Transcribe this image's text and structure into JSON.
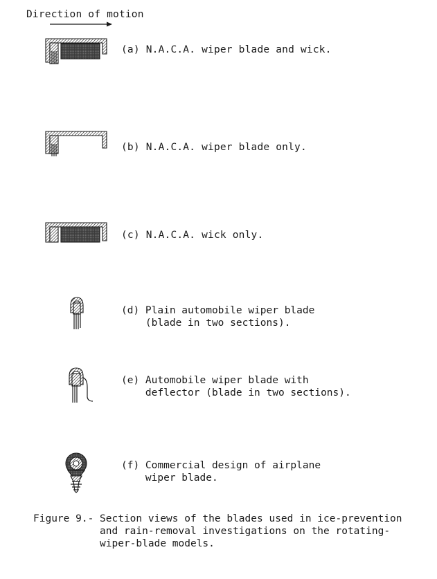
{
  "header": {
    "direction_label": "Direction of motion"
  },
  "items": [
    {
      "id": "a",
      "lines": [
        "(a) N.A.C.A. wiper blade and wick."
      ]
    },
    {
      "id": "b",
      "lines": [
        "(b) N.A.C.A. wiper blade only."
      ]
    },
    {
      "id": "c",
      "lines": [
        "(c) N.A.C.A. wick only."
      ]
    },
    {
      "id": "d",
      "lines": [
        "(d) Plain automobile wiper blade",
        "    (blade in two sections)."
      ]
    },
    {
      "id": "e",
      "lines": [
        "(e) Automobile wiper blade with",
        "    deflector (blade in two sections)."
      ]
    },
    {
      "id": "f",
      "lines": [
        "(f) Commercial design of airplane",
        "    wiper blade."
      ]
    }
  ],
  "caption": {
    "line1": "Figure 9.- Section views of the blades used in ice-prevention",
    "line2": "           and rain-removal investigations on the rotating-",
    "line3": "           wiper-blade models."
  }
}
